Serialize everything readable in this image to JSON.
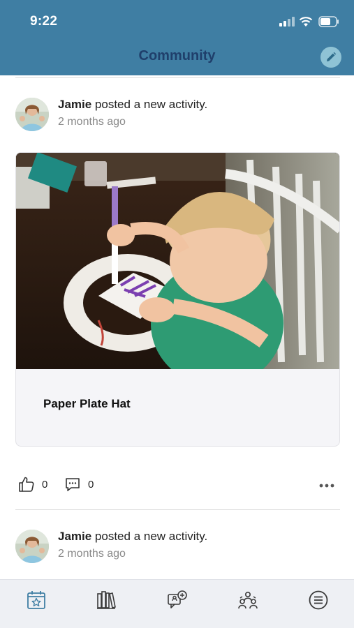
{
  "status_bar": {
    "time": "9:22"
  },
  "header": {
    "title": "Community",
    "edit_icon": "pencil-icon"
  },
  "posts": [
    {
      "author": "Jamie",
      "action": " posted a new activity.",
      "time_ago": "2 months ago"
    },
    {
      "author": "Jamie",
      "action": " posted a new activity.",
      "time_ago": "2 months ago"
    }
  ],
  "activity_card": {
    "title": "Paper Plate Hat"
  },
  "reactions": {
    "likes": "0",
    "comments": "0",
    "like_icon": "thumbs-up-icon",
    "comment_icon": "comment-icon",
    "more_icon": "more-dots-icon"
  },
  "tab_bar": {
    "items": [
      "calendar-star-icon",
      "library-books-icon",
      "community-chat-icon",
      "people-group-icon",
      "menu-list-icon"
    ],
    "active_index": 0,
    "active_color": "#3f7ea3",
    "inactive_color": "#3a3a3a"
  },
  "colors": {
    "header": "#3f7ea3",
    "title": "#1f3f6b",
    "edit_button": "#8fc3d5"
  }
}
